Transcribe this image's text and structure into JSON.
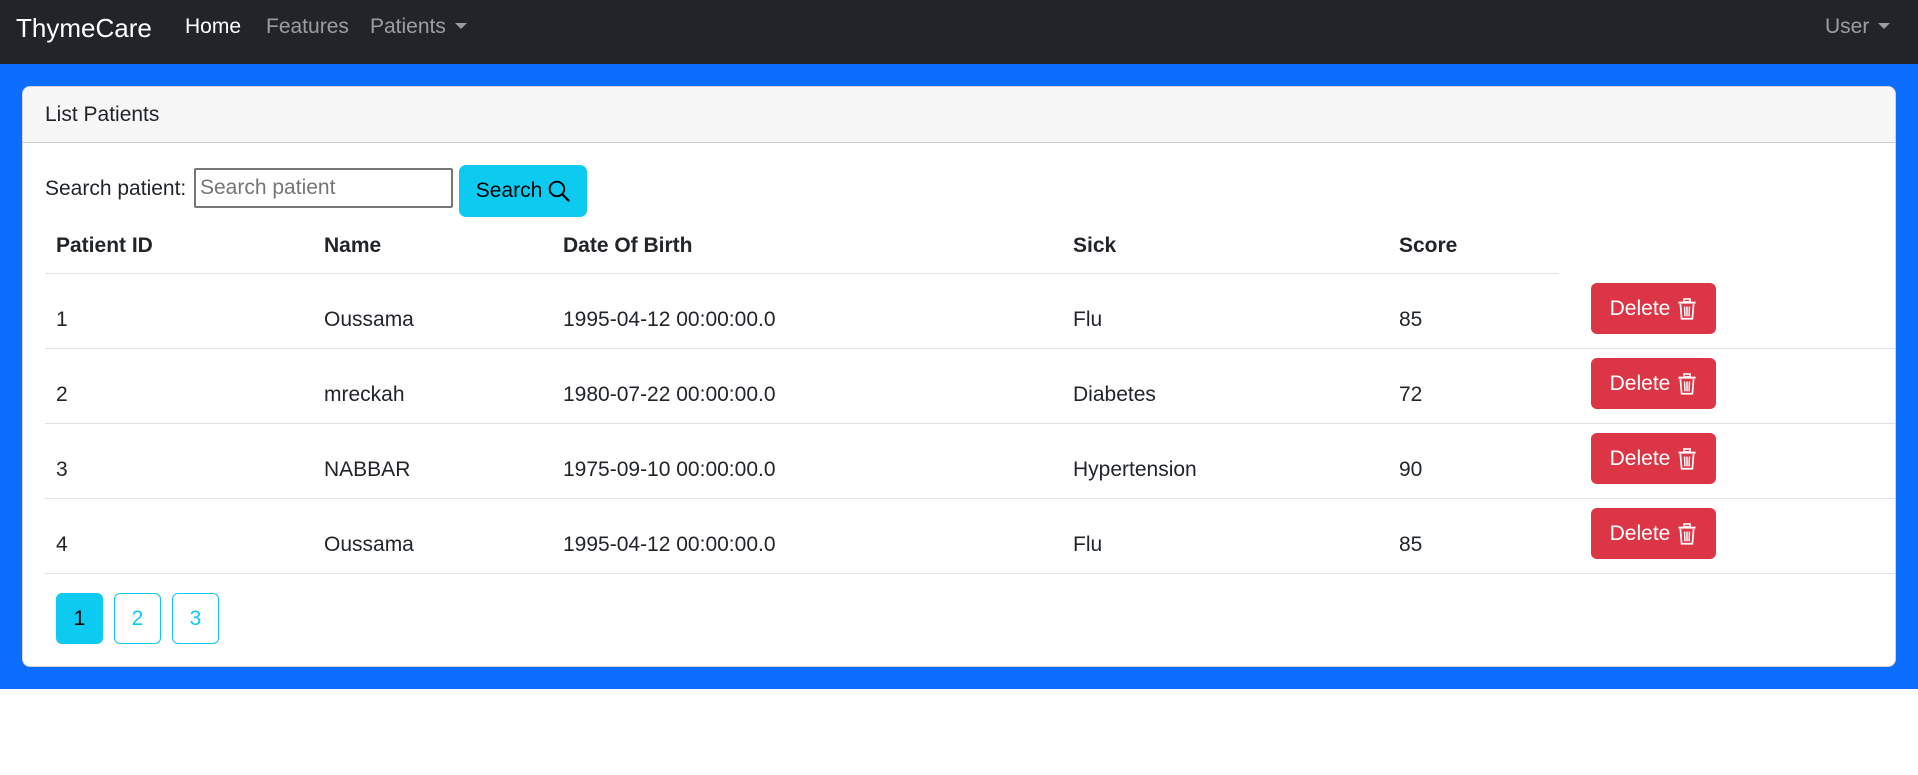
{
  "navbar": {
    "brand": "ThymeCare",
    "links": [
      {
        "label": "Home",
        "active": true
      },
      {
        "label": "Features",
        "active": false
      },
      {
        "label": "Patients",
        "dropdown": true
      }
    ],
    "user": "User"
  },
  "card": {
    "header": "List Patients",
    "search": {
      "label": "Search patient:",
      "placeholder": "Search patient",
      "value": "",
      "button_label": "Search",
      "button_icon": "search-icon"
    },
    "table": {
      "columns": [
        "Patient ID",
        "Name",
        "Date Of Birth",
        "Sick",
        "Score"
      ],
      "rows": [
        {
          "id": "1",
          "name": "Oussama",
          "dob": "1995-04-12 00:00:00.0",
          "sick": "Flu",
          "score": "85",
          "action": "Delete"
        },
        {
          "id": "2",
          "name": "mreckah",
          "dob": "1980-07-22 00:00:00.0",
          "sick": "Diabetes",
          "score": "72",
          "action": "Delete"
        },
        {
          "id": "3",
          "name": "NABBAR",
          "dob": "1975-09-10 00:00:00.0",
          "sick": "Hypertension",
          "score": "90",
          "action": "Delete"
        },
        {
          "id": "4",
          "name": "Oussama",
          "dob": "1995-04-12 00:00:00.0",
          "sick": "Flu",
          "score": "85",
          "action": "Delete"
        }
      ]
    },
    "pagination": {
      "pages": [
        "1",
        "2",
        "3"
      ],
      "current": "1"
    }
  },
  "colors": {
    "navbar_bg": "#212529",
    "band_bg": "#0d6efd",
    "info": "#0dcaf0",
    "danger": "#dc3545"
  }
}
